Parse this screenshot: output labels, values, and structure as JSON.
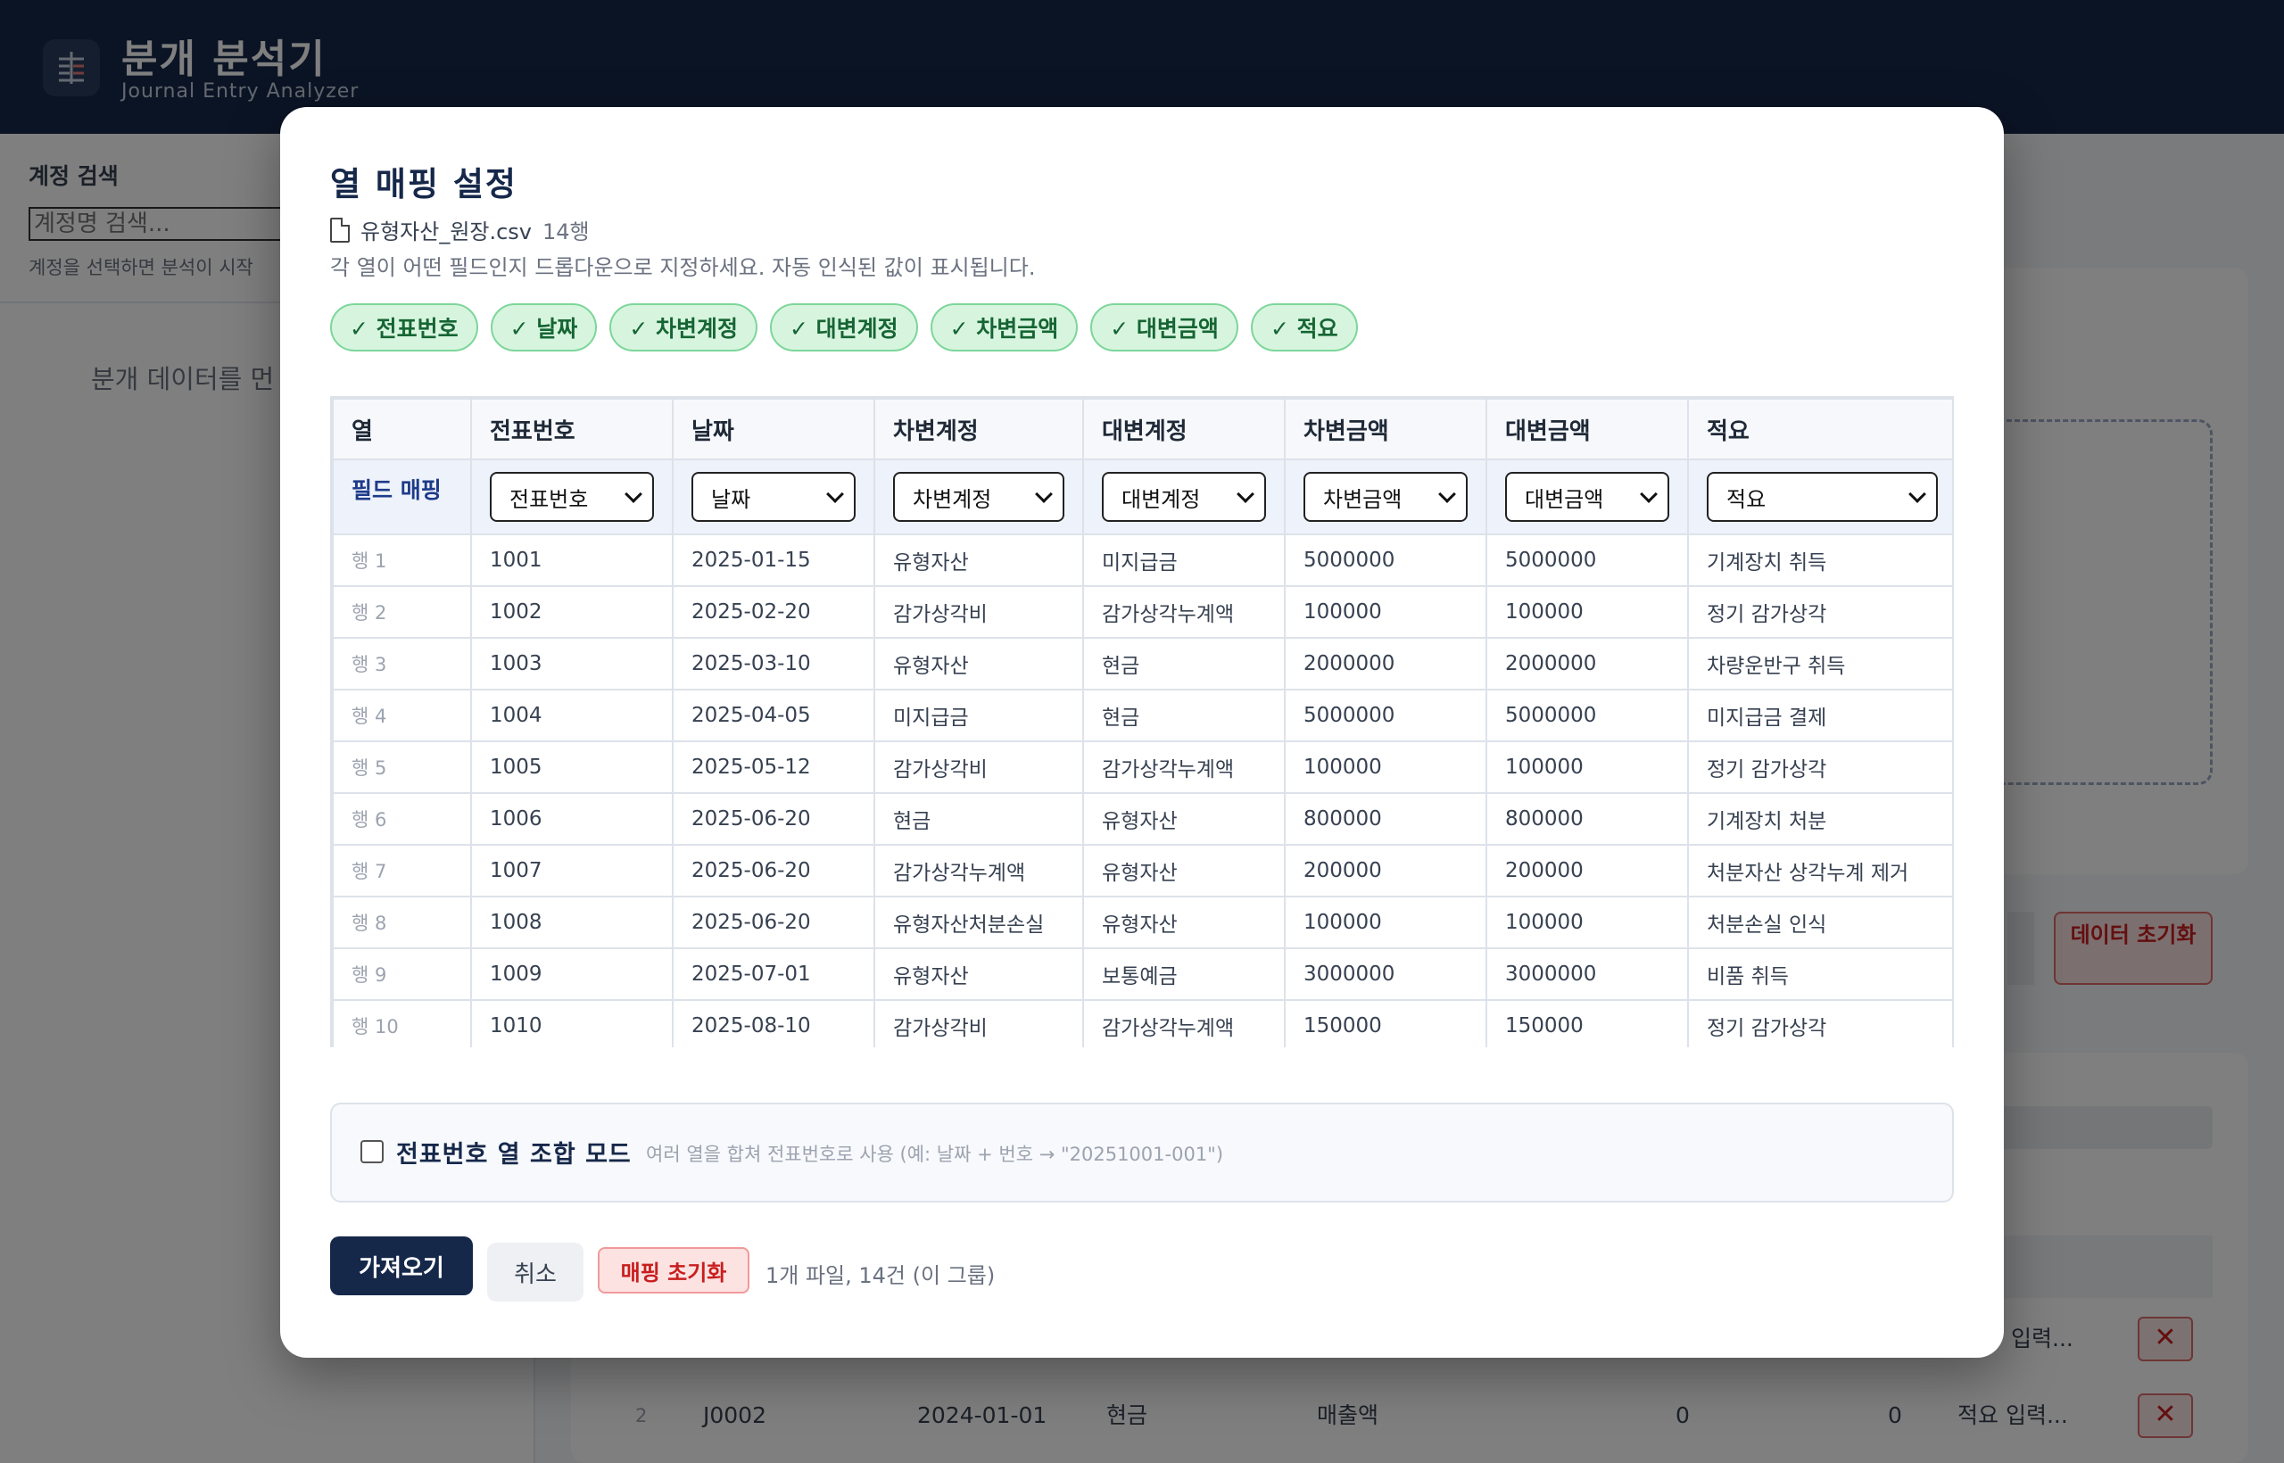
{
  "app": {
    "title": "분개 분석기",
    "subtitle": "Journal Entry Analyzer"
  },
  "sidebar": {
    "account_label": "계정 검색",
    "search_placeholder": "계정명 검색...",
    "hint": "계정을 선택하면 분석이 시작",
    "empty_text": "분개 데이터를 먼"
  },
  "background": {
    "reset_data_label": "데이터 초기화",
    "rows": [
      {
        "no": "",
        "code": "",
        "date": "",
        "debit": "",
        "credit": "",
        "d_amt": "",
        "c_amt": "",
        "memo": "입력..."
      },
      {
        "no": "2",
        "code": "J0002",
        "date": "2024-01-01",
        "debit": "현금",
        "credit": "매출액",
        "d_amt": "0",
        "c_amt": "0",
        "memo": "적요 입력..."
      }
    ],
    "delete_icon": "✕"
  },
  "modal": {
    "title": "열 매핑 설정",
    "file_name": "유형자산_원장.csv",
    "row_count": "14행",
    "instruction": "각 열이 어떤 필드인지 드롭다운으로 지정하세요. 자동 인식된 값이 표시됩니다.",
    "chips": [
      "✓ 전표번호",
      "✓ 날짜",
      "✓ 차변계정",
      "✓ 대변계정",
      "✓ 차변금액",
      "✓ 대변금액",
      "✓ 적요"
    ],
    "table": {
      "col_header": "열",
      "columns": [
        "전표번호",
        "날짜",
        "차변계정",
        "대변계정",
        "차변금액",
        "대변금액",
        "적요"
      ],
      "mapping_label": "필드 매핑",
      "mapping_values": [
        "전표번호",
        "날짜",
        "차변계정",
        "대변계정",
        "차변금액",
        "대변금액",
        "적요"
      ],
      "rows": [
        {
          "label": "행 1",
          "cells": [
            "1001",
            "2025-01-15",
            "유형자산",
            "미지급금",
            "5000000",
            "5000000",
            "기계장치 취득"
          ]
        },
        {
          "label": "행 2",
          "cells": [
            "1002",
            "2025-02-20",
            "감가상각비",
            "감가상각누계액",
            "100000",
            "100000",
            "정기 감가상각"
          ]
        },
        {
          "label": "행 3",
          "cells": [
            "1003",
            "2025-03-10",
            "유형자산",
            "현금",
            "2000000",
            "2000000",
            "차량운반구 취득"
          ]
        },
        {
          "label": "행 4",
          "cells": [
            "1004",
            "2025-04-05",
            "미지급금",
            "현금",
            "5000000",
            "5000000",
            "미지급금 결제"
          ]
        },
        {
          "label": "행 5",
          "cells": [
            "1005",
            "2025-05-12",
            "감가상각비",
            "감가상각누계액",
            "100000",
            "100000",
            "정기 감가상각"
          ]
        },
        {
          "label": "행 6",
          "cells": [
            "1006",
            "2025-06-20",
            "현금",
            "유형자산",
            "800000",
            "800000",
            "기계장치 처분"
          ]
        },
        {
          "label": "행 7",
          "cells": [
            "1007",
            "2025-06-20",
            "감가상각누계액",
            "유형자산",
            "200000",
            "200000",
            "처분자산 상각누계 제거"
          ]
        },
        {
          "label": "행 8",
          "cells": [
            "1008",
            "2025-06-20",
            "유형자산처분손실",
            "유형자산",
            "100000",
            "100000",
            "처분손실 인식"
          ]
        },
        {
          "label": "행 9",
          "cells": [
            "1009",
            "2025-07-01",
            "유형자산",
            "보통예금",
            "3000000",
            "3000000",
            "비품 취득"
          ]
        },
        {
          "label": "행 10",
          "cells": [
            "1010",
            "2025-08-10",
            "감가상각비",
            "감가상각누계액",
            "150000",
            "150000",
            "정기 감가상각"
          ]
        }
      ]
    },
    "combo": {
      "title": "전표번호 열 조합 모드",
      "description": "여러 열을 합쳐 전표번호로 사용 (예: 날짜 + 번호 → \"20251001-001\")"
    },
    "buttons": {
      "import": "가져오기",
      "cancel": "취소",
      "reset_mapping": "매핑 초기화"
    },
    "status": "1개 파일, 14건 (이 그룹)"
  }
}
